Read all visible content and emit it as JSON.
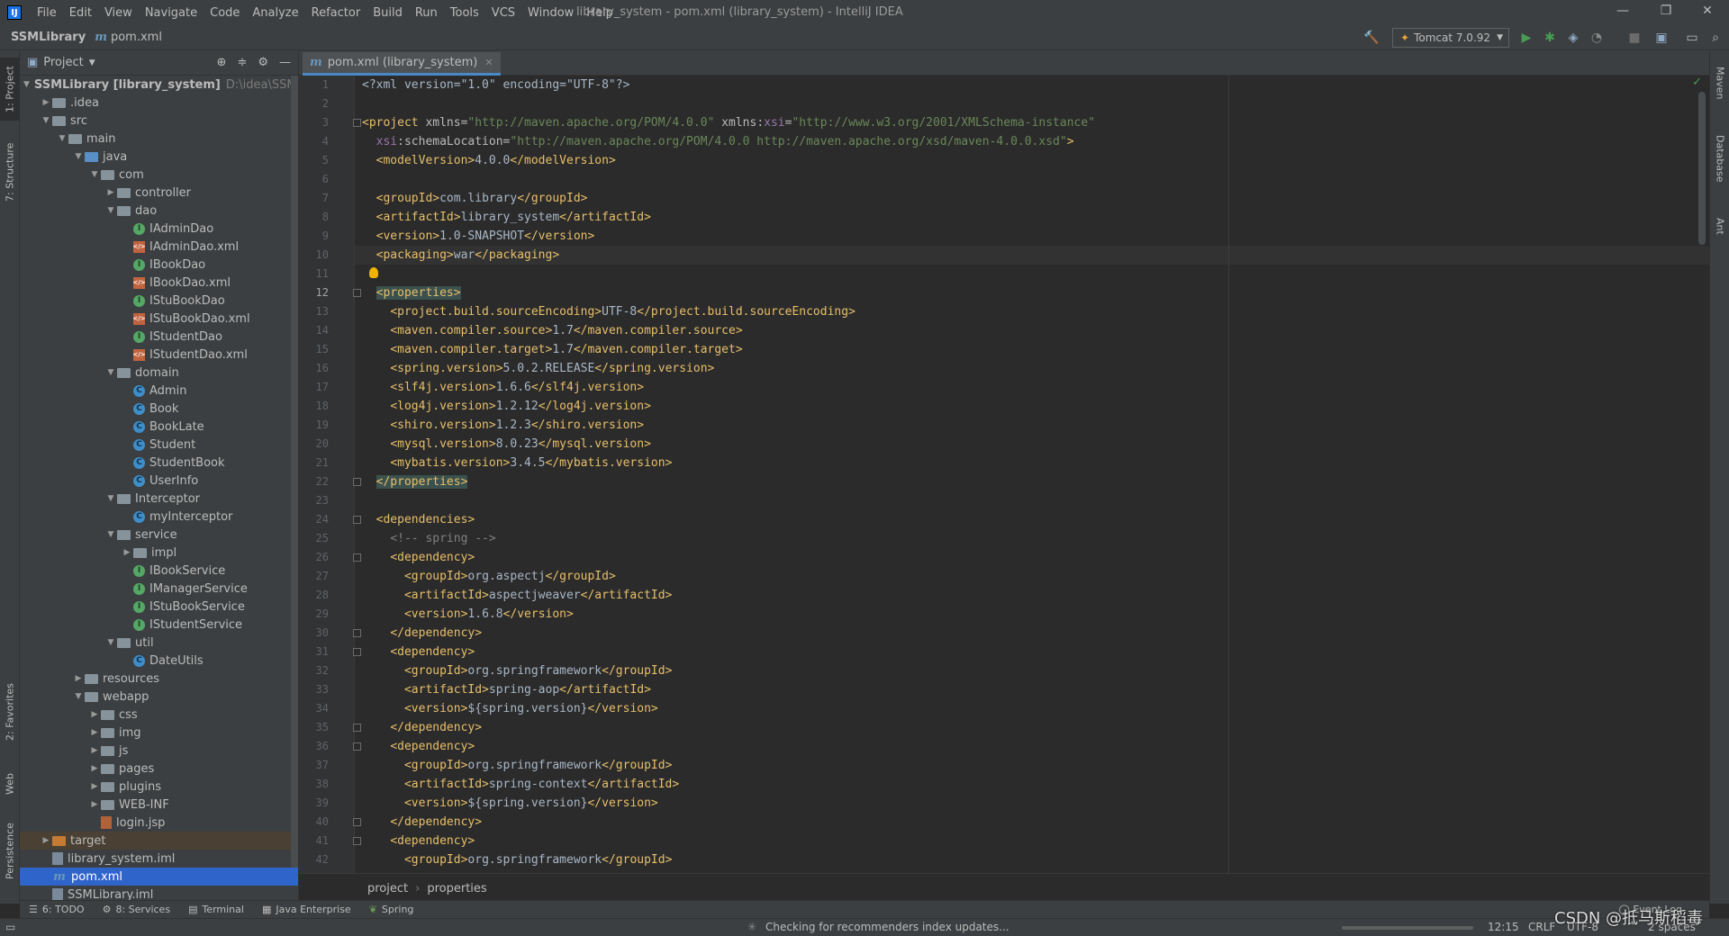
{
  "menubar": {
    "items": [
      "File",
      "Edit",
      "View",
      "Navigate",
      "Code",
      "Analyze",
      "Refactor",
      "Build",
      "Run",
      "Tools",
      "VCS",
      "Window",
      "Help"
    ],
    "window_title": "library_system - pom.xml (library_system) - IntelliJ IDEA",
    "minimize": "—",
    "restore": "❐",
    "close": "✕"
  },
  "navbar": {
    "project": "SSMLibrary",
    "file": "pom.xml",
    "run_config": "Tomcat 7.0.92"
  },
  "left_strip": {
    "project": "1: Project",
    "structure": "7: Structure",
    "favorites": "2: Favorites",
    "web": "Web",
    "persistence": "Persistence"
  },
  "right_strip": {
    "maven": "Maven",
    "database": "Database",
    "ant": "Ant"
  },
  "project_panel": {
    "title": "Project",
    "tree": [
      {
        "label": "SSMLibrary [library_system]",
        "depth": 0,
        "arrow": "▼",
        "icon": "folder",
        "hint": "D:\\idea\\SSMLibr",
        "bold": true
      },
      {
        "label": ".idea",
        "depth": 1,
        "arrow": "▶",
        "icon": "folder"
      },
      {
        "label": "src",
        "depth": 1,
        "arrow": "▼",
        "icon": "folder"
      },
      {
        "label": "main",
        "depth": 2,
        "arrow": "▼",
        "icon": "folder"
      },
      {
        "label": "java",
        "depth": 3,
        "arrow": "▼",
        "icon": "folder-src"
      },
      {
        "label": "com",
        "depth": 4,
        "arrow": "▼",
        "icon": "folder"
      },
      {
        "label": "controller",
        "depth": 5,
        "arrow": "▶",
        "icon": "folder"
      },
      {
        "label": "dao",
        "depth": 5,
        "arrow": "▼",
        "icon": "folder"
      },
      {
        "label": "IAdminDao",
        "depth": 6,
        "arrow": "",
        "icon": "interface"
      },
      {
        "label": "IAdminDao.xml",
        "depth": 6,
        "arrow": "",
        "icon": "xml"
      },
      {
        "label": "IBookDao",
        "depth": 6,
        "arrow": "",
        "icon": "interface"
      },
      {
        "label": "IBookDao.xml",
        "depth": 6,
        "arrow": "",
        "icon": "xml"
      },
      {
        "label": "IStuBookDao",
        "depth": 6,
        "arrow": "",
        "icon": "interface"
      },
      {
        "label": "IStuBookDao.xml",
        "depth": 6,
        "arrow": "",
        "icon": "xml"
      },
      {
        "label": "IStudentDao",
        "depth": 6,
        "arrow": "",
        "icon": "interface"
      },
      {
        "label": "IStudentDao.xml",
        "depth": 6,
        "arrow": "",
        "icon": "xml"
      },
      {
        "label": "domain",
        "depth": 5,
        "arrow": "▼",
        "icon": "folder"
      },
      {
        "label": "Admin",
        "depth": 6,
        "arrow": "",
        "icon": "class"
      },
      {
        "label": "Book",
        "depth": 6,
        "arrow": "",
        "icon": "class"
      },
      {
        "label": "BookLate",
        "depth": 6,
        "arrow": "",
        "icon": "class"
      },
      {
        "label": "Student",
        "depth": 6,
        "arrow": "",
        "icon": "class"
      },
      {
        "label": "StudentBook",
        "depth": 6,
        "arrow": "",
        "icon": "class"
      },
      {
        "label": "UserInfo",
        "depth": 6,
        "arrow": "",
        "icon": "class"
      },
      {
        "label": "Interceptor",
        "depth": 5,
        "arrow": "▼",
        "icon": "folder"
      },
      {
        "label": "myInterceptor",
        "depth": 6,
        "arrow": "",
        "icon": "class"
      },
      {
        "label": "service",
        "depth": 5,
        "arrow": "▼",
        "icon": "folder"
      },
      {
        "label": "impl",
        "depth": 6,
        "arrow": "▶",
        "icon": "folder"
      },
      {
        "label": "IBookService",
        "depth": 6,
        "arrow": "",
        "icon": "interface"
      },
      {
        "label": "IManagerService",
        "depth": 6,
        "arrow": "",
        "icon": "interface"
      },
      {
        "label": "IStuBookService",
        "depth": 6,
        "arrow": "",
        "icon": "interface"
      },
      {
        "label": "IStudentService",
        "depth": 6,
        "arrow": "",
        "icon": "interface"
      },
      {
        "label": "util",
        "depth": 5,
        "arrow": "▼",
        "icon": "folder"
      },
      {
        "label": "DateUtils",
        "depth": 6,
        "arrow": "",
        "icon": "class"
      },
      {
        "label": "resources",
        "depth": 3,
        "arrow": "▶",
        "icon": "folder"
      },
      {
        "label": "webapp",
        "depth": 3,
        "arrow": "▼",
        "icon": "folder"
      },
      {
        "label": "css",
        "depth": 4,
        "arrow": "▶",
        "icon": "folder"
      },
      {
        "label": "img",
        "depth": 4,
        "arrow": "▶",
        "icon": "folder"
      },
      {
        "label": "js",
        "depth": 4,
        "arrow": "▶",
        "icon": "folder"
      },
      {
        "label": "pages",
        "depth": 4,
        "arrow": "▶",
        "icon": "folder"
      },
      {
        "label": "plugins",
        "depth": 4,
        "arrow": "▶",
        "icon": "folder"
      },
      {
        "label": "WEB-INF",
        "depth": 4,
        "arrow": "▶",
        "icon": "folder"
      },
      {
        "label": "login.jsp",
        "depth": 4,
        "arrow": "",
        "icon": "jsp"
      },
      {
        "label": "target",
        "depth": 1,
        "arrow": "▶",
        "icon": "folder-target",
        "excluded": true
      },
      {
        "label": "library_system.iml",
        "depth": 1,
        "arrow": "",
        "icon": "iml"
      },
      {
        "label": "pom.xml",
        "depth": 1,
        "arrow": "",
        "icon": "pom",
        "selected": true
      },
      {
        "label": "SSMLibrary.iml",
        "depth": 1,
        "arrow": "",
        "icon": "iml"
      }
    ]
  },
  "editor": {
    "tab_label": "pom.xml (library_system)",
    "current_line": 12,
    "lines": [
      [
        [
          "txt",
          "<?xml version=\"1.0\" encoding=\"UTF-8\"?>"
        ]
      ],
      [],
      [
        [
          "tag",
          "<project "
        ],
        [
          "attr",
          "xmlns="
        ],
        [
          "attrv",
          "\"http://maven.apache.org/POM/4.0.0\""
        ],
        [
          "attr",
          " xmlns:"
        ],
        [
          "ns",
          "xsi"
        ],
        [
          "attr",
          "="
        ],
        [
          "attrv",
          "\"http://www.w3.org/2001/XMLSchema-instance\""
        ]
      ],
      [
        [
          "txt",
          "  "
        ],
        [
          "ns",
          "xsi"
        ],
        [
          "attr",
          ":schemaLocation="
        ],
        [
          "attrv",
          "\"http://maven.apache.org/POM/4.0.0 http://maven.apache.org/xsd/maven-4.0.0.xsd\""
        ],
        [
          "tag",
          ">"
        ]
      ],
      [
        [
          "txt",
          "  "
        ],
        [
          "tag",
          "<modelVersion>"
        ],
        [
          "txt",
          "4.0.0"
        ],
        [
          "tag",
          "</modelVersion>"
        ]
      ],
      [],
      [
        [
          "txt",
          "  "
        ],
        [
          "tag",
          "<groupId>"
        ],
        [
          "txt",
          "com.library"
        ],
        [
          "tag",
          "</groupId>"
        ]
      ],
      [
        [
          "txt",
          "  "
        ],
        [
          "tag",
          "<artifactId>"
        ],
        [
          "txt",
          "library_system"
        ],
        [
          "tag",
          "</artifactId>"
        ]
      ],
      [
        [
          "txt",
          "  "
        ],
        [
          "tag",
          "<version>"
        ],
        [
          "txt",
          "1.0-SNAPSHOT"
        ],
        [
          "tag",
          "</version>"
        ]
      ],
      [
        [
          "txt",
          "  "
        ],
        [
          "tag",
          "<packaging>"
        ],
        [
          "txt",
          "war"
        ],
        [
          "tag",
          "</packaging>"
        ]
      ],
      [],
      [
        [
          "txt",
          "  "
        ],
        [
          "hl",
          "<properties>"
        ]
      ],
      [
        [
          "txt",
          "    "
        ],
        [
          "tag",
          "<project.build.sourceEncoding>"
        ],
        [
          "txt",
          "UTF-8"
        ],
        [
          "tag",
          "</project.build.sourceEncoding>"
        ]
      ],
      [
        [
          "txt",
          "    "
        ],
        [
          "tag",
          "<maven.compiler.source>"
        ],
        [
          "txt",
          "1.7"
        ],
        [
          "tag",
          "</maven.compiler.source>"
        ]
      ],
      [
        [
          "txt",
          "    "
        ],
        [
          "tag",
          "<maven.compiler.target>"
        ],
        [
          "txt",
          "1.7"
        ],
        [
          "tag",
          "</maven.compiler.target>"
        ]
      ],
      [
        [
          "txt",
          "    "
        ],
        [
          "tag",
          "<spring.version>"
        ],
        [
          "txt",
          "5.0.2.RELEASE"
        ],
        [
          "tag",
          "</spring.version>"
        ]
      ],
      [
        [
          "txt",
          "    "
        ],
        [
          "tag",
          "<slf4j.version>"
        ],
        [
          "txt",
          "1.6.6"
        ],
        [
          "tag",
          "</slf4j.version>"
        ]
      ],
      [
        [
          "txt",
          "    "
        ],
        [
          "tag",
          "<log4j.version>"
        ],
        [
          "txt",
          "1.2.12"
        ],
        [
          "tag",
          "</log4j.version>"
        ]
      ],
      [
        [
          "txt",
          "    "
        ],
        [
          "tag",
          "<shiro.version>"
        ],
        [
          "txt",
          "1.2.3"
        ],
        [
          "tag",
          "</shiro.version>"
        ]
      ],
      [
        [
          "txt",
          "    "
        ],
        [
          "tag",
          "<mysql.version>"
        ],
        [
          "txt",
          "8.0.23"
        ],
        [
          "tag",
          "</mysql.version>"
        ]
      ],
      [
        [
          "txt",
          "    "
        ],
        [
          "tag",
          "<mybatis.version>"
        ],
        [
          "txt",
          "3.4.5"
        ],
        [
          "tag",
          "</mybatis.version>"
        ]
      ],
      [
        [
          "txt",
          "  "
        ],
        [
          "hl",
          "</properties>"
        ]
      ],
      [],
      [
        [
          "txt",
          "  "
        ],
        [
          "tag",
          "<dependencies>"
        ]
      ],
      [
        [
          "txt",
          "    "
        ],
        [
          "cmt",
          "<!-- spring -->"
        ]
      ],
      [
        [
          "txt",
          "    "
        ],
        [
          "tag",
          "<dependency>"
        ]
      ],
      [
        [
          "txt",
          "      "
        ],
        [
          "tag",
          "<groupId>"
        ],
        [
          "txt",
          "org.aspectj"
        ],
        [
          "tag",
          "</groupId>"
        ]
      ],
      [
        [
          "txt",
          "      "
        ],
        [
          "tag",
          "<artifactId>"
        ],
        [
          "txt",
          "aspectjweaver"
        ],
        [
          "tag",
          "</artifactId>"
        ]
      ],
      [
        [
          "txt",
          "      "
        ],
        [
          "tag",
          "<version>"
        ],
        [
          "txt",
          "1.6.8"
        ],
        [
          "tag",
          "</version>"
        ]
      ],
      [
        [
          "txt",
          "    "
        ],
        [
          "tag",
          "</dependency>"
        ]
      ],
      [
        [
          "txt",
          "    "
        ],
        [
          "tag",
          "<dependency>"
        ]
      ],
      [
        [
          "txt",
          "      "
        ],
        [
          "tag",
          "<groupId>"
        ],
        [
          "txt",
          "org.springframework"
        ],
        [
          "tag",
          "</groupId>"
        ]
      ],
      [
        [
          "txt",
          "      "
        ],
        [
          "tag",
          "<artifactId>"
        ],
        [
          "txt",
          "spring-aop"
        ],
        [
          "tag",
          "</artifactId>"
        ]
      ],
      [
        [
          "txt",
          "      "
        ],
        [
          "tag",
          "<version>"
        ],
        [
          "txt",
          "${spring.version}"
        ],
        [
          "tag",
          "</version>"
        ]
      ],
      [
        [
          "txt",
          "    "
        ],
        [
          "tag",
          "</dependency>"
        ]
      ],
      [
        [
          "txt",
          "    "
        ],
        [
          "tag",
          "<dependency>"
        ]
      ],
      [
        [
          "txt",
          "      "
        ],
        [
          "tag",
          "<groupId>"
        ],
        [
          "txt",
          "org.springframework"
        ],
        [
          "tag",
          "</groupId>"
        ]
      ],
      [
        [
          "txt",
          "      "
        ],
        [
          "tag",
          "<artifactId>"
        ],
        [
          "txt",
          "spring-context"
        ],
        [
          "tag",
          "</artifactId>"
        ]
      ],
      [
        [
          "txt",
          "      "
        ],
        [
          "tag",
          "<version>"
        ],
        [
          "txt",
          "${spring.version}"
        ],
        [
          "tag",
          "</version>"
        ]
      ],
      [
        [
          "txt",
          "    "
        ],
        [
          "tag",
          "</dependency>"
        ]
      ],
      [
        [
          "txt",
          "    "
        ],
        [
          "tag",
          "<dependency>"
        ]
      ],
      [
        [
          "txt",
          "      "
        ],
        [
          "tag",
          "<groupId>"
        ],
        [
          "txt",
          "org.springframework"
        ],
        [
          "tag",
          "</groupId>"
        ]
      ]
    ]
  },
  "breadcrumb": {
    "items": [
      "project",
      "properties"
    ]
  },
  "tool_tabs": {
    "todo": "6: TODO",
    "services": "8: Services",
    "terminal": "Terminal",
    "java_enterprise": "Java Enterprise",
    "spring": "Spring",
    "event_log": "Event Log"
  },
  "status": {
    "message": "Checking for recommenders index updates...",
    "position": "12:15",
    "line_sep": "CRLF",
    "encoding": "UTF-8",
    "indent": "2 spaces"
  },
  "watermark": "CSDN @抵马斯稻毒"
}
